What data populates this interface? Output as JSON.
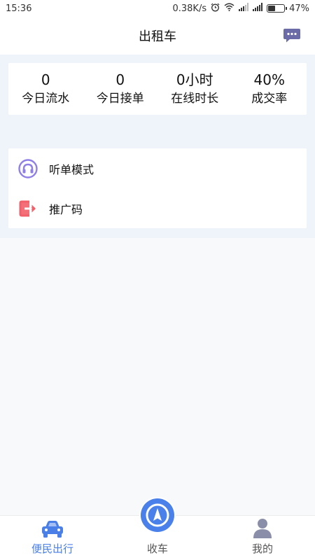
{
  "status_bar": {
    "time": "15:36",
    "speed": "0.38K/s",
    "battery": "47%",
    "battery_level": 0.47
  },
  "header": {
    "title": "出租车",
    "message_icon": "chat-bubble-icon"
  },
  "stats": [
    {
      "value": "0",
      "label": "今日流水"
    },
    {
      "value": "0",
      "label": "今日接单"
    },
    {
      "value": "0小时",
      "label": "在线时长"
    },
    {
      "value": "40%",
      "label": "成交率"
    }
  ],
  "menu": {
    "items": [
      {
        "label": "听单模式",
        "icon": "headphones-icon",
        "color": "#8f7fe6"
      },
      {
        "label": "推广码",
        "icon": "share-icon",
        "color": "#f2616a"
      }
    ]
  },
  "tabbar": {
    "tabs": [
      {
        "label": "便民出行",
        "icon": "car-icon",
        "active": true
      },
      {
        "label": "收车",
        "icon": "navigation-icon",
        "active": false
      },
      {
        "label": "我的",
        "icon": "person-icon",
        "active": false
      }
    ]
  },
  "colors": {
    "accent": "#4a7fe8",
    "band": "#eff4fb",
    "background": "#f8f9fb",
    "message_icon": "#6b6ba8"
  }
}
